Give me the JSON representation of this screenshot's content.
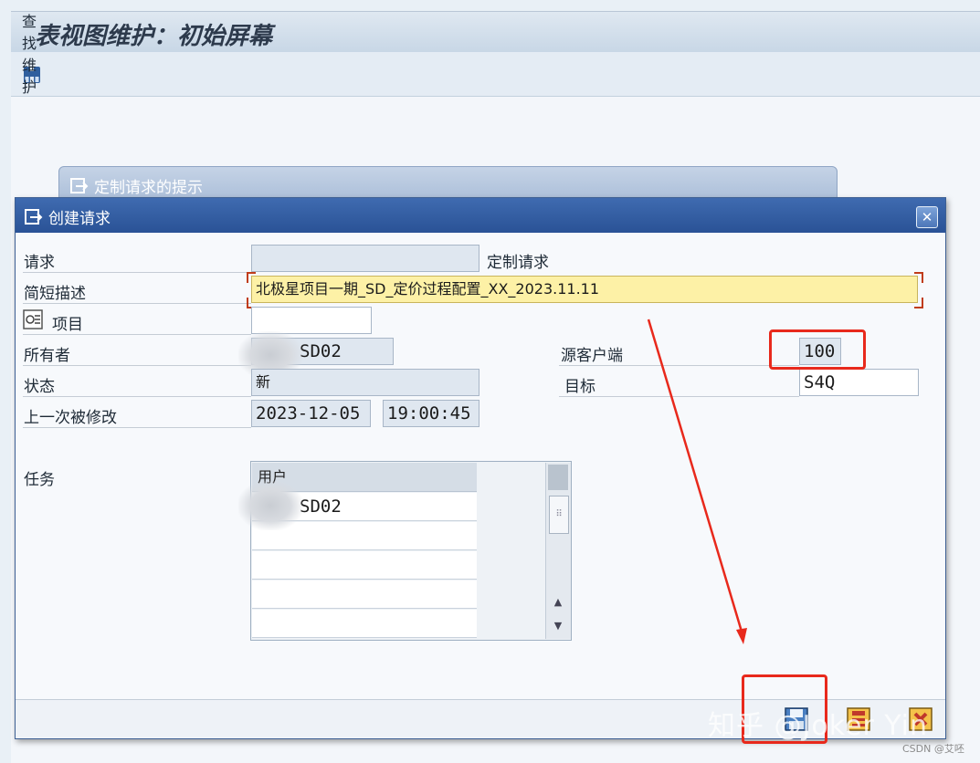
{
  "page": {
    "title": "表视图维护：初始屏幕",
    "toolbar_find": "查找维护对话"
  },
  "background_popup": {
    "title": "定制请求的提示"
  },
  "dialog": {
    "title": "创建请求",
    "close": "✕",
    "fields": {
      "request_label": "请求",
      "request_value": "",
      "request_type": "定制请求",
      "short_desc_label": "简短描述",
      "short_desc_value": "北极星项目一期_SD_定价过程配置_XX_2023.11.11",
      "project_label": "项目",
      "project_value": "",
      "owner_label": "所有者",
      "owner_value": "SD02",
      "status_label": "状态",
      "status_value": "新",
      "last_changed_label": "上一次被修改",
      "last_changed_date": "2023-12-05",
      "last_changed_time": "19:00:45",
      "source_client_label": "源客户端",
      "source_client_value": "100",
      "target_label": "目标",
      "target_value": "S4Q"
    },
    "tasks": {
      "label": "任务",
      "column_header": "用户",
      "rows": [
        "SD02",
        "",
        "",
        "",
        ""
      ]
    },
    "footer_buttons": [
      "save-icon",
      "local-request-icon",
      "cancel-icon"
    ]
  },
  "watermark": {
    "main": "知乎 @Joker Yin",
    "small": "CSDN @艾呸"
  },
  "colors": {
    "titlebar": "#2a5296",
    "highlight_field": "#fdf1a6",
    "annotation_red": "#e8291c"
  }
}
